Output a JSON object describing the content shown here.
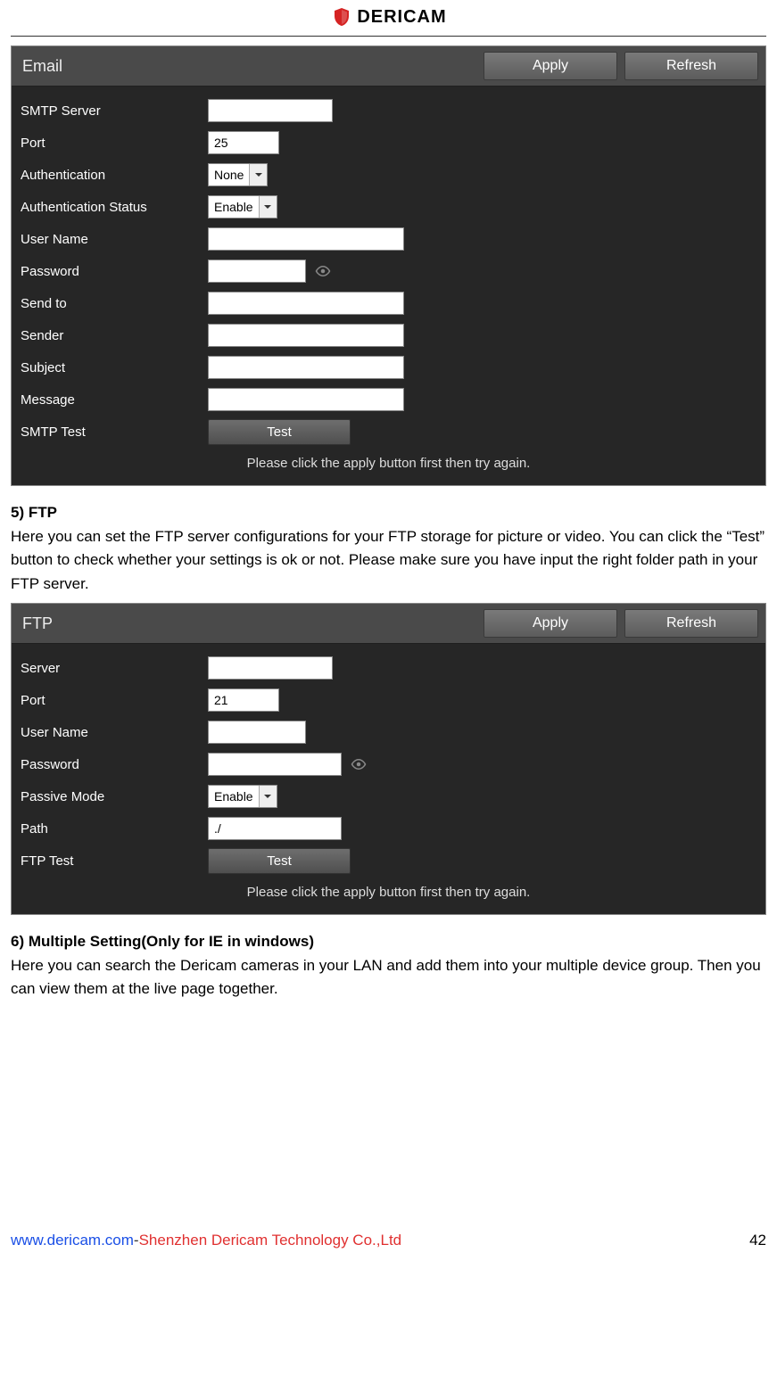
{
  "logo": {
    "brand": "DERICAM"
  },
  "emailPanel": {
    "title": "Email",
    "apply": "Apply",
    "refresh": "Refresh",
    "rows": {
      "smtp": {
        "label": "SMTP Server",
        "value": ""
      },
      "port": {
        "label": "Port",
        "value": "25"
      },
      "auth": {
        "label": "Authentication",
        "value": "None"
      },
      "authst": {
        "label": "Authentication Status",
        "value": "Enable"
      },
      "user": {
        "label": "User Name",
        "value": ""
      },
      "pass": {
        "label": "Password",
        "value": ""
      },
      "sendto": {
        "label": "Send to",
        "value": ""
      },
      "sender": {
        "label": "Sender",
        "value": ""
      },
      "subject": {
        "label": "Subject",
        "value": ""
      },
      "message": {
        "label": "Message",
        "value": ""
      },
      "test": {
        "label": "SMTP Test",
        "button": "Test"
      }
    },
    "hint": "Please click the apply button first then try again."
  },
  "section5": {
    "heading": "5) FTP",
    "paragraph": "Here you can set the FTP server configurations for your FTP storage for picture or video. You can click the “Test” button to check whether your settings is ok or not. Please make sure you have input the right folder path in your FTP server."
  },
  "ftpPanel": {
    "title": "FTP",
    "apply": "Apply",
    "refresh": "Refresh",
    "rows": {
      "server": {
        "label": "Server",
        "value": ""
      },
      "port": {
        "label": "Port",
        "value": "21"
      },
      "user": {
        "label": "User Name",
        "value": ""
      },
      "pass": {
        "label": "Password",
        "value": ""
      },
      "passive": {
        "label": "Passive Mode",
        "value": "Enable"
      },
      "path": {
        "label": "Path",
        "value": "./"
      },
      "test": {
        "label": "FTP Test",
        "button": "Test"
      }
    },
    "hint": "Please click the apply button first then try again."
  },
  "section6": {
    "heading": "6) Multiple Setting(Only for IE in windows)",
    "paragraph": "Here you can search the Dericam cameras in your LAN and add them into your multiple device group. Then you can view them at the live page together."
  },
  "footer": {
    "site": "www.dericam.com",
    "dash": "-",
    "company": "Shenzhen Dericam Technology Co.,Ltd",
    "page": "42"
  }
}
